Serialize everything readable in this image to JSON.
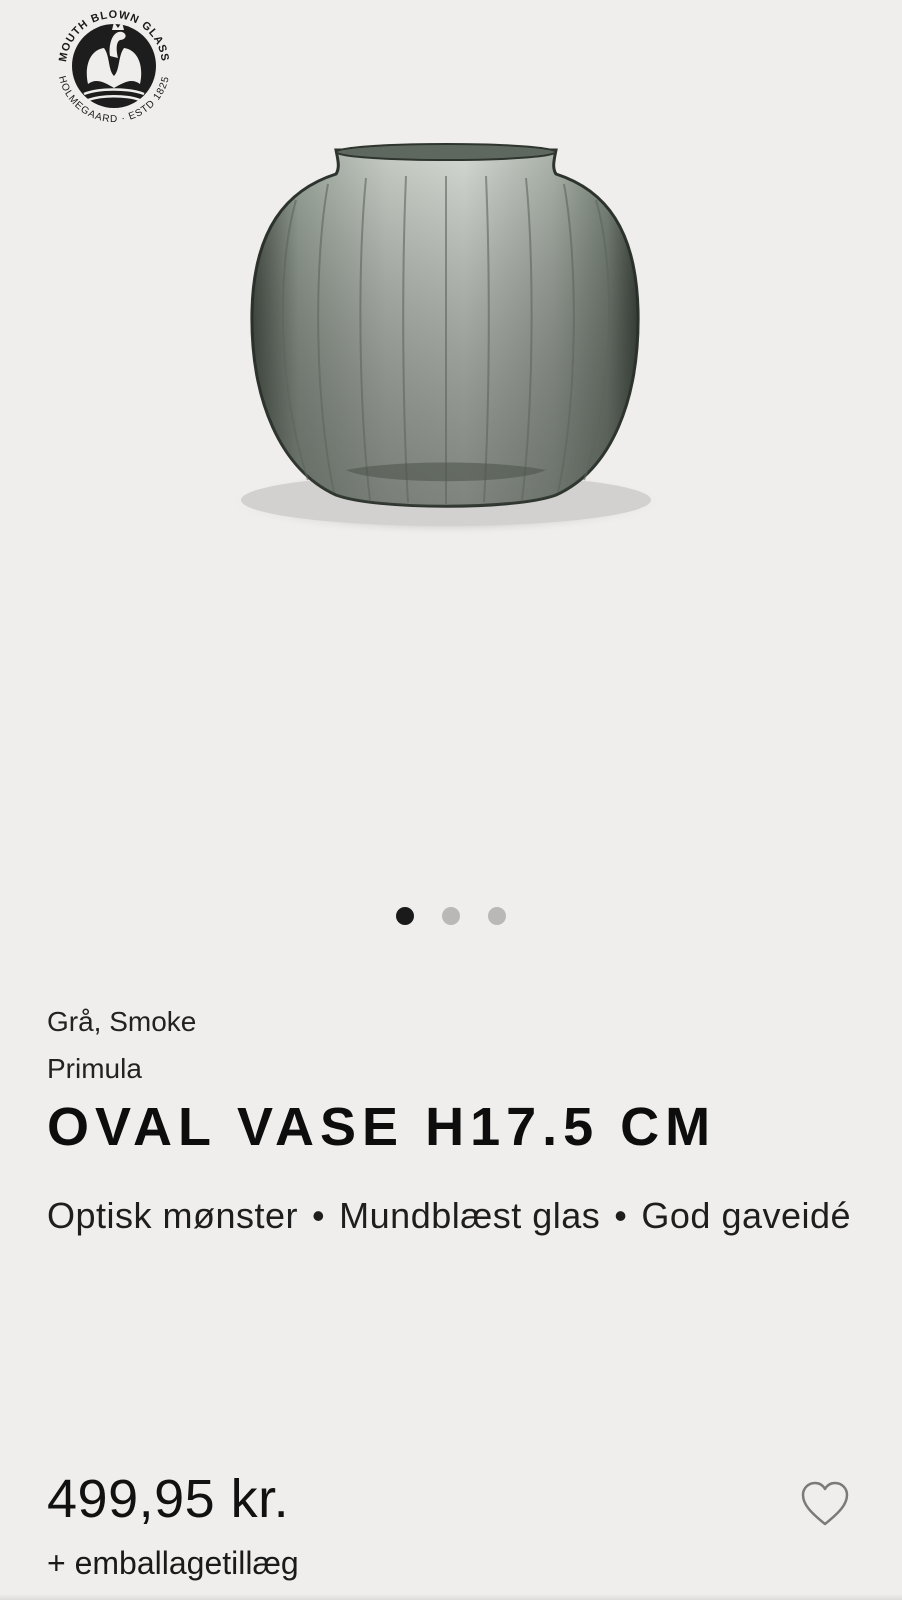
{
  "brand": {
    "logo_text_top": "MOUTH BLOWN GLASS",
    "logo_text_bottom": "HOLMEGAARD · ESTD 1825",
    "icon": "swan-logo-icon"
  },
  "gallery": {
    "image_count": 3,
    "active_index": 0
  },
  "product": {
    "color": "Grå, Smoke",
    "series": "Primula",
    "title": "OVAL VASE H17.5 CM",
    "features_line1": "Optisk mønster",
    "features_line2": "Mundblæst glas",
    "features_line3": "God gaveidé",
    "separator": "•",
    "price": "499,95 kr.",
    "fee_note": "+ emballagetillæg"
  },
  "wishlist": {
    "icon": "heart-icon"
  },
  "colors": {
    "background": "#efeeed",
    "text": "#111111",
    "dot_active": "#1a1a1a",
    "dot_inactive": "#b9b8b6",
    "vase_tint": "#8f9a8f"
  }
}
